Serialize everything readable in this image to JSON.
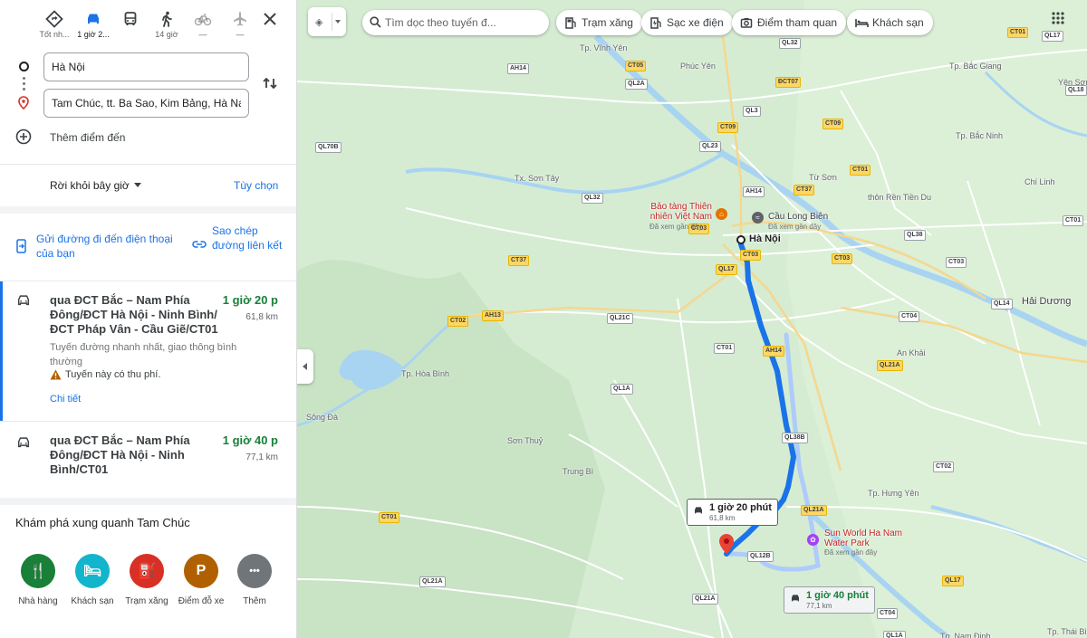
{
  "travel_modes": [
    {
      "id": "best",
      "label": "Tốt nh...",
      "icon": "diamond-route-icon",
      "state": "normal"
    },
    {
      "id": "car",
      "label": "1 giờ 2...",
      "icon": "car-icon",
      "state": "active"
    },
    {
      "id": "bus",
      "label": "",
      "icon": "bus-icon",
      "state": "normal"
    },
    {
      "id": "walk",
      "label": "14 giờ",
      "icon": "walk-icon",
      "state": "normal"
    },
    {
      "id": "bike",
      "label": "—",
      "icon": "bike-icon",
      "state": "disabled"
    },
    {
      "id": "flight",
      "label": "—",
      "icon": "airplane-icon",
      "state": "disabled"
    }
  ],
  "waypoints": {
    "origin": "Hà Nội",
    "destination": "Tam Chúc, tt. Ba Sao, Kim Bảng, Hà Nam",
    "add_label": "Thêm điểm đến"
  },
  "depart": {
    "label": "Rời khỏi bây giờ",
    "options": "Tùy chọn"
  },
  "share": {
    "send": "Gửi đường đi đến điện thoại của bạn",
    "copy": "Sao chép đường liên kết"
  },
  "routes": [
    {
      "title": "qua ĐCT Bắc – Nam Phía Đông/ĐCT Hà Nội - Ninh Bình/ ĐCT Pháp Vân - Cầu Giẽ/CT01",
      "time": "1 giờ 20 p",
      "distance": "61,8 km",
      "description": "Tuyến đường nhanh nhất, giao thông bình thường",
      "warning": "Tuyến này có thu phí.",
      "details": "Chi tiết"
    },
    {
      "title": "qua ĐCT Bắc – Nam Phía Đông/ĐCT Hà Nội - Ninh Bình/CT01",
      "time": "1 giờ 40 p",
      "distance": "77,1 km"
    }
  ],
  "explore": {
    "title": "Khám phá xung quanh Tam Chúc",
    "items": [
      {
        "label": "Nhà hàng",
        "icon": "restaurant-icon",
        "color": "#188038",
        "glyph": "🍴"
      },
      {
        "label": "Khách sạn",
        "icon": "hotel-icon",
        "color": "#12b5cb",
        "glyph": "🛏"
      },
      {
        "label": "Trạm xăng",
        "icon": "gas-station-icon",
        "color": "#d93025",
        "glyph": "⛽"
      },
      {
        "label": "Điểm đỗ xe",
        "icon": "parking-icon",
        "color": "#b06000",
        "glyph": "P"
      },
      {
        "label": "Thêm",
        "icon": "more-icon",
        "color": "#70757a",
        "glyph": "•••"
      }
    ]
  },
  "map": {
    "search_placeholder": "Tìm dọc theo tuyến đ...",
    "chips": [
      "Trạm xăng",
      "Sạc xe điện",
      "Điểm tham quan",
      "Khách sạn"
    ],
    "places": [
      {
        "name": "Tp. Vĩnh Yên",
        "big": false
      },
      {
        "name": "Phúc Yên",
        "big": false
      },
      {
        "name": "Tp. Bắc Giang",
        "big": false
      },
      {
        "name": "Yên Sơn",
        "big": false
      },
      {
        "name": "Tp. Bắc Ninh",
        "big": false
      },
      {
        "name": "Tx. Sơn Tây",
        "big": false
      },
      {
        "name": "Từ Sơn",
        "big": false
      },
      {
        "name": "thôn Rền Tiền Du",
        "big": false
      },
      {
        "name": "Chí Linh",
        "big": false
      },
      {
        "name": "Hà Nội",
        "big": true
      },
      {
        "name": "Hải Dương",
        "big": true
      },
      {
        "name": "An Khải",
        "big": false
      },
      {
        "name": "Tp. Hòa Bình",
        "big": false
      },
      {
        "name": "Sông Đà",
        "big": false
      },
      {
        "name": "Sơn Thuỷ",
        "big": false
      },
      {
        "name": "Trung Bì",
        "big": false
      },
      {
        "name": "Tp. Hưng Yên",
        "big": false
      },
      {
        "name": "Tp. Thái Bìn",
        "big": false
      },
      {
        "name": "Tp. Nam Định",
        "big": false
      }
    ],
    "road_badges": [
      {
        "label": "AH14"
      },
      {
        "label": "CT05"
      },
      {
        "label": "QL2A"
      },
      {
        "label": "ĐCT07"
      },
      {
        "label": "QL17"
      },
      {
        "label": "CT01"
      },
      {
        "label": "QL32"
      },
      {
        "label": "QL3"
      },
      {
        "label": "CT09"
      },
      {
        "label": "CT09"
      },
      {
        "label": "QL70B"
      },
      {
        "label": "QL23"
      },
      {
        "label": "QL18"
      },
      {
        "label": "CT01"
      },
      {
        "label": "CT37"
      },
      {
        "label": "QL32"
      },
      {
        "label": "AH14"
      },
      {
        "label": "CT03"
      },
      {
        "label": "CT03"
      },
      {
        "label": "CT03"
      },
      {
        "label": "CT37"
      },
      {
        "label": "QL17"
      },
      {
        "label": "QL38"
      },
      {
        "label": "CT03"
      },
      {
        "label": "CT02"
      },
      {
        "label": "AH13"
      },
      {
        "label": "QL21C"
      },
      {
        "label": "CT01"
      },
      {
        "label": "AH14"
      },
      {
        "label": "QL14"
      },
      {
        "label": "CT04"
      },
      {
        "label": "QL21A"
      },
      {
        "label": "QL1A"
      },
      {
        "label": "QL38B"
      },
      {
        "label": "CT02"
      },
      {
        "label": "CT01"
      },
      {
        "label": "QL21A"
      },
      {
        "label": "QL12B"
      },
      {
        "label": "QL21A"
      },
      {
        "label": "QL21A"
      },
      {
        "label": "CT04"
      },
      {
        "label": "QL17"
      },
      {
        "label": "CT01"
      },
      {
        "label": "QL1A"
      }
    ],
    "pois": [
      {
        "name": "Bảo tàng Thiên nhiên Việt Nam",
        "sub": "Đã xem gần đây"
      },
      {
        "name": "Cầu Long Biên",
        "sub": "Đã xem gần đây"
      },
      {
        "name": "Sun World Ha Nam Water Park",
        "sub": "Đã xem gần đây"
      }
    ],
    "callouts": [
      {
        "time": "1 giờ 20 phút",
        "distance": "61,8 km"
      },
      {
        "time": "1 giờ 40 phút",
        "distance": "77,1 km"
      }
    ],
    "colors": {
      "route_primary": "#1a73e8",
      "route_alt": "#aecbfa",
      "land": "#d5ecd3",
      "water": "#a8d4f2",
      "road": "#ffffff"
    }
  }
}
